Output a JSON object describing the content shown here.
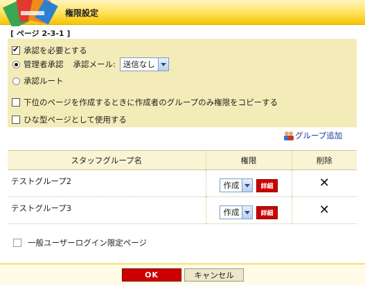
{
  "header": {
    "title": "権限設定",
    "logo_icon": "books-logo-icon"
  },
  "page_id": "[ ページ 2-3-1 ]",
  "options": {
    "require_approval": {
      "label": "承認を必要とする",
      "checked": true
    },
    "approval_admin": {
      "label": "管理者承認",
      "selected": true
    },
    "approval_mail": {
      "label": "承認メール:",
      "value": "送信なし"
    },
    "approval_route": {
      "label": "承認ルート",
      "selected": false
    },
    "copy_creator_group": {
      "label": "下位のページを作成するときに作成者のグループのみ権限をコピーする",
      "checked": false
    },
    "use_as_template": {
      "label": "ひな型ページとして使用する",
      "checked": false
    }
  },
  "add_group": {
    "label": "グループ追加",
    "icon": "group-add-icon"
  },
  "table": {
    "headers": {
      "name": "スタッフグループ名",
      "permission": "権限",
      "delete": "削除"
    },
    "rows": [
      {
        "name": "テストグループ2",
        "permission": "作成",
        "detail": "詳細",
        "delete": "✕"
      },
      {
        "name": "テストグループ3",
        "permission": "作成",
        "detail": "詳細",
        "delete": "✕"
      }
    ]
  },
  "login_only": {
    "label": "一般ユーザーログイン限定ページ",
    "checked": false
  },
  "footer": {
    "ok": "OK",
    "cancel": "キャンセル"
  },
  "colors": {
    "accent_red": "#cc0000",
    "header_yellow": "#ffe05a",
    "panel_bg": "#f3ecb8"
  }
}
